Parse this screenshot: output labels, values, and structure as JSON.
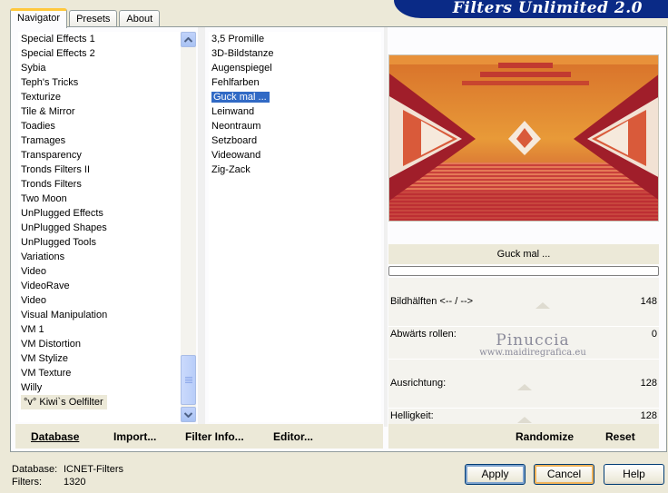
{
  "tabs": [
    {
      "label": "Navigator",
      "active": true
    },
    {
      "label": "Presets",
      "active": false
    },
    {
      "label": "About",
      "active": false
    }
  ],
  "banner": {
    "title": "Filters Unlimited 2.0"
  },
  "categories": [
    "Special Effects 1",
    "Special Effects 2",
    "Sybia",
    "Teph's Tricks",
    "Texturize",
    "Tile & Mirror",
    "Toadies",
    "Tramages",
    "Transparency",
    "Tronds Filters II",
    "Tronds Filters",
    "Two Moon",
    "UnPlugged Effects",
    "UnPlugged Shapes",
    "UnPlugged Tools",
    "Variations",
    "Video",
    "VideoRave",
    "Video",
    "Visual Manipulation",
    "VM 1",
    "VM Distortion",
    "VM Stylize",
    "VM Texture",
    "Willy",
    "°v° Kiwi`s Oelfilter"
  ],
  "selected_category_index": 25,
  "filters": [
    "3,5 Promille",
    "3D-Bildstanze",
    "Augenspiegel",
    "Fehlfarben",
    "Guck mal ...",
    "Leinwand",
    "Neontraum",
    "Setzboard",
    "Videowand",
    "Zig-Zack"
  ],
  "selected_filter_index": 4,
  "preview": {
    "filter_name": "Guck mal ..."
  },
  "params": [
    {
      "label": "Bildhälften <-- / -->",
      "value": "148",
      "level": 0.58
    },
    {
      "label": "Abwärts rollen:",
      "value": "0",
      "level": 0.0
    },
    {
      "label": "Ausrichtung:",
      "value": "128",
      "level": 0.5
    },
    {
      "label": "Helligkeit:",
      "value": "128",
      "level": 0.5
    }
  ],
  "watermark": {
    "line1": "Pinuccia",
    "line2": "www.maidiregrafica.eu"
  },
  "bottom_buttons": {
    "database": "Database",
    "import": "Import...",
    "filter_info": "Filter Info...",
    "editor": "Editor...",
    "randomize": "Randomize",
    "reset": "Reset"
  },
  "footer": {
    "database_label": "Database:",
    "database_value": "ICNET-Filters",
    "filters_label": "Filters:",
    "filters_value": "1320"
  },
  "dialog_buttons": {
    "apply": "Apply",
    "cancel": "Cancel",
    "help": "Help"
  },
  "colors": {
    "selection": "#316ac5",
    "banner": "#0a2a86",
    "tab_highlight": "#ffc83c"
  }
}
